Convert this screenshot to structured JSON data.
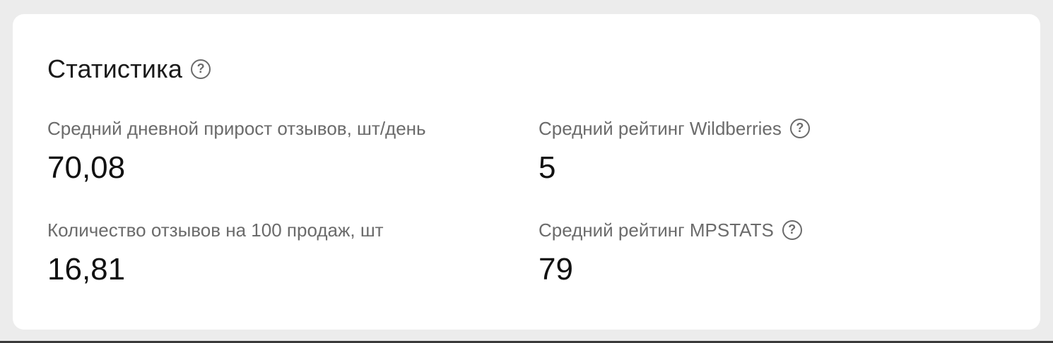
{
  "card": {
    "title": "Статистика",
    "help_icon": "question-circle-icon"
  },
  "stats": [
    {
      "label": "Средний дневной прирост отзывов, шт/день",
      "value": "70,08",
      "has_help": false
    },
    {
      "label": "Средний рейтинг Wildberries",
      "value": "5",
      "has_help": true
    },
    {
      "label": "Количество отзывов на 100 продаж, шт",
      "value": "16,81",
      "has_help": false
    },
    {
      "label": "Средний рейтинг MPSTATS",
      "value": "79",
      "has_help": true
    }
  ],
  "colors": {
    "background": "#ececec",
    "card": "#ffffff",
    "label": "#6b6b6b",
    "value": "#111111"
  }
}
